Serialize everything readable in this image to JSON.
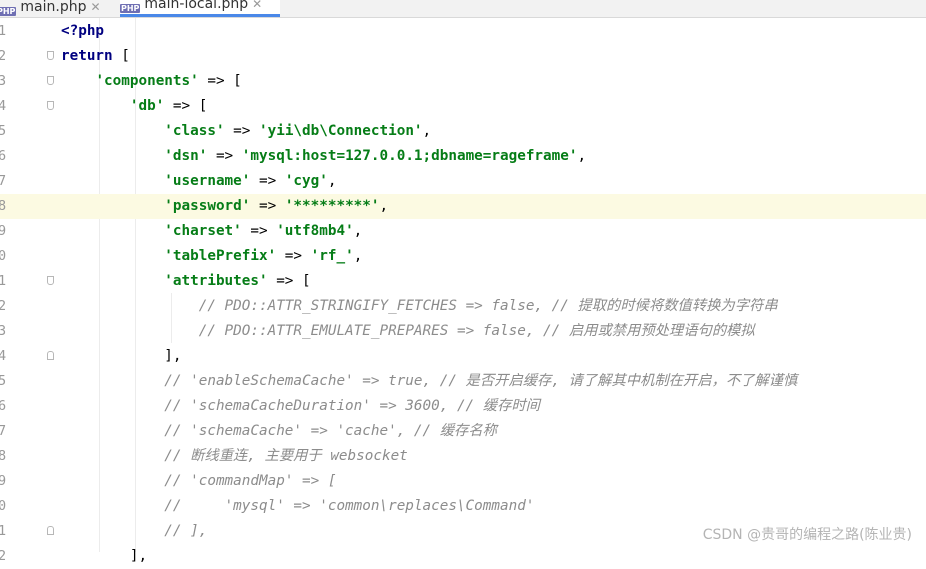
{
  "tabs": [
    {
      "label": "main.php",
      "icon": "php-file-icon",
      "icon_text": "PHP"
    },
    {
      "label": "main-local.php",
      "icon": "php-file-icon",
      "icon_text": "PHP"
    }
  ],
  "code_lines": [
    {
      "n": "1",
      "tokens": [
        [
          "kw",
          "<?php"
        ]
      ]
    },
    {
      "n": "2",
      "tokens": [
        [
          "kw",
          "return"
        ],
        [
          "op",
          " ["
        ]
      ]
    },
    {
      "n": "3",
      "tokens": [
        [
          "op",
          "    "
        ],
        [
          "str",
          "'components'"
        ],
        [
          "op",
          " => ["
        ]
      ]
    },
    {
      "n": "4",
      "tokens": [
        [
          "op",
          "        "
        ],
        [
          "str",
          "'db'"
        ],
        [
          "op",
          " => ["
        ]
      ]
    },
    {
      "n": "5",
      "tokens": [
        [
          "op",
          "            "
        ],
        [
          "str",
          "'class'"
        ],
        [
          "op",
          " => "
        ],
        [
          "str",
          "'yii\\db\\Connection'"
        ],
        [
          "op",
          ","
        ]
      ]
    },
    {
      "n": "6",
      "tokens": [
        [
          "op",
          "            "
        ],
        [
          "str",
          "'dsn'"
        ],
        [
          "op",
          " => "
        ],
        [
          "str",
          "'mysql:host=127.0.0.1;dbname=rageframe'"
        ],
        [
          "op",
          ","
        ]
      ]
    },
    {
      "n": "7",
      "tokens": [
        [
          "op",
          "            "
        ],
        [
          "str",
          "'username'"
        ],
        [
          "op",
          " => "
        ],
        [
          "str",
          "'cyg'"
        ],
        [
          "op",
          ","
        ]
      ]
    },
    {
      "n": "8",
      "tokens": [
        [
          "op",
          "            "
        ],
        [
          "str",
          "'password'"
        ],
        [
          "op",
          " => "
        ],
        [
          "str",
          "'*********'"
        ],
        [
          "op",
          ","
        ]
      ]
    },
    {
      "n": "9",
      "tokens": [
        [
          "op",
          "            "
        ],
        [
          "str",
          "'charset'"
        ],
        [
          "op",
          " => "
        ],
        [
          "str",
          "'utf8mb4'"
        ],
        [
          "op",
          ","
        ]
      ]
    },
    {
      "n": "0",
      "tokens": [
        [
          "op",
          "            "
        ],
        [
          "str",
          "'tablePrefix'"
        ],
        [
          "op",
          " => "
        ],
        [
          "str",
          "'rf_'"
        ],
        [
          "op",
          ","
        ]
      ]
    },
    {
      "n": "1",
      "tokens": [
        [
          "op",
          "            "
        ],
        [
          "str",
          "'attributes'"
        ],
        [
          "op",
          " => ["
        ]
      ]
    },
    {
      "n": "2",
      "tokens": [
        [
          "op",
          "                "
        ],
        [
          "cm",
          "// PDO::ATTR_STRINGIFY_FETCHES => false, // 提取的时候将数值转换为字符串"
        ]
      ]
    },
    {
      "n": "3",
      "tokens": [
        [
          "op",
          "                "
        ],
        [
          "cm",
          "// PDO::ATTR_EMULATE_PREPARES => false, // 启用或禁用预处理语句的模拟"
        ]
      ]
    },
    {
      "n": "4",
      "tokens": [
        [
          "op",
          "            ],"
        ]
      ]
    },
    {
      "n": "5",
      "tokens": [
        [
          "op",
          "            "
        ],
        [
          "cm",
          "// 'enableSchemaCache' => true, // 是否开启缓存, 请了解其中机制在开启，不了解谨慎"
        ]
      ]
    },
    {
      "n": "6",
      "tokens": [
        [
          "op",
          "            "
        ],
        [
          "cm",
          "// 'schemaCacheDuration' => 3600, // 缓存时间"
        ]
      ]
    },
    {
      "n": "7",
      "tokens": [
        [
          "op",
          "            "
        ],
        [
          "cm",
          "// 'schemaCache' => 'cache', // 缓存名称"
        ]
      ]
    },
    {
      "n": "8",
      "tokens": [
        [
          "op",
          "            "
        ],
        [
          "cm",
          "// 断线重连, 主要用于 websocket"
        ]
      ]
    },
    {
      "n": "9",
      "tokens": [
        [
          "op",
          "            "
        ],
        [
          "cm",
          "// 'commandMap' => ["
        ]
      ]
    },
    {
      "n": "0",
      "tokens": [
        [
          "op",
          "            "
        ],
        [
          "cm",
          "//     'mysql' => 'common\\replaces\\Command'"
        ]
      ]
    },
    {
      "n": "1",
      "tokens": [
        [
          "op",
          "            "
        ],
        [
          "cm",
          "// ],"
        ]
      ]
    },
    {
      "n": "2",
      "tokens": [
        [
          "op",
          "        ],"
        ]
      ]
    }
  ],
  "watermark": "CSDN @贵哥的编程之路(陈业贵)",
  "colors": {
    "keyword": "#000080",
    "string": "#067d17",
    "comment": "#8c8c8c",
    "current_line": "#fcfae2",
    "active_tab_underline": "#4a88e8"
  }
}
